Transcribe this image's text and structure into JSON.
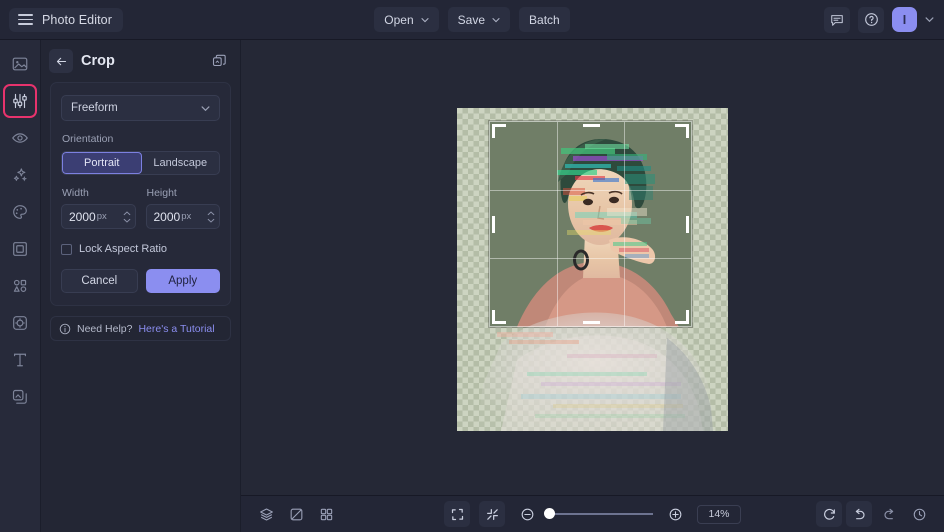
{
  "app": {
    "title": "Photo Editor",
    "menu_icon": "hamburger-icon"
  },
  "topbar": {
    "open_label": "Open",
    "save_label": "Save",
    "batch_label": "Batch",
    "feedback_icon": "comment-icon",
    "help_icon": "question-circle-icon",
    "avatar_initial": "I",
    "account_caret_icon": "chevron-down-icon"
  },
  "sidebar": {
    "items": [
      {
        "name": "image",
        "icon": "image-icon",
        "active": false
      },
      {
        "name": "adjust",
        "icon": "sliders-icon",
        "active": true
      },
      {
        "name": "retouch",
        "icon": "eye-icon",
        "active": false
      },
      {
        "name": "effects",
        "icon": "sparkles-icon",
        "active": false
      },
      {
        "name": "filters",
        "icon": "palette-icon",
        "active": false
      },
      {
        "name": "frames",
        "icon": "frame-icon",
        "active": false
      },
      {
        "name": "shapes",
        "icon": "shapes-icon",
        "active": false
      },
      {
        "name": "stickers",
        "icon": "sticker-icon",
        "active": false
      },
      {
        "name": "text",
        "icon": "text-icon",
        "active": false
      },
      {
        "name": "layers",
        "icon": "layers-copy-icon",
        "active": false
      }
    ]
  },
  "panel": {
    "back_icon": "arrow-left-icon",
    "title": "Crop",
    "header_icon": "duplicate-icon",
    "aspect": {
      "value": "Freeform",
      "caret_icon": "chevron-down-icon"
    },
    "orientation": {
      "label": "Orientation",
      "options": [
        "Portrait",
        "Landscape"
      ],
      "selected": "Portrait"
    },
    "width": {
      "label": "Width",
      "value": "2000",
      "unit": "px",
      "stepper_icon": "stepper-icon"
    },
    "height": {
      "label": "Height",
      "value": "2000",
      "unit": "px",
      "stepper_icon": "stepper-icon"
    },
    "lock_aspect": {
      "label": "Lock Aspect Ratio",
      "checked": false
    },
    "cancel_label": "Cancel",
    "apply_label": "Apply",
    "help": {
      "icon": "info-icon",
      "text": "Need Help?",
      "link": "Here's a Tutorial"
    }
  },
  "canvas": {
    "crop_overlay": {
      "grid": "rule-of-thirds",
      "handles": [
        "top-left",
        "top-center",
        "top-right",
        "middle-left",
        "middle-right",
        "bottom-left",
        "bottom-center",
        "bottom-right"
      ]
    },
    "image_alt": "glitch-art portrait of a woman on transparent background"
  },
  "bottombar": {
    "layers_icon": "layers-icon",
    "compare_icon": "compare-icon",
    "grid_icon": "grid-icon",
    "fit_icon": "fit-screen-icon",
    "actual_icon": "collapse-icon",
    "zoom_out_icon": "minus-circle-icon",
    "zoom_in_icon": "plus-circle-icon",
    "zoom_value": "14%",
    "zoom_slider_pct": 0,
    "reset_icon": "refresh-icon",
    "undo_icon": "undo-icon",
    "redo_icon": "redo-icon",
    "history_icon": "history-icon"
  },
  "colors": {
    "accent": "#8b8ef0",
    "active_outline": "#e8336d",
    "topbar_bg": "#232636",
    "panel_bg": "#232634",
    "canvas_bg": "#252836"
  }
}
